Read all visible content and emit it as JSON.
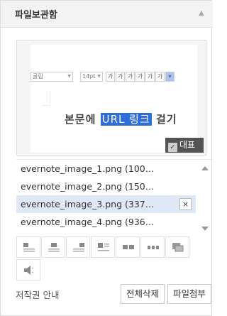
{
  "header": {
    "title": "파일보관함",
    "toggle_icon": "collapse-triangle-icon"
  },
  "preview": {
    "toolbar": {
      "font": "굴림",
      "size": "14pt",
      "buttons": [
        "가",
        "가",
        "가",
        "가",
        "가",
        "가"
      ]
    },
    "text_before": "본문에 ",
    "text_link": "URL 링크",
    "text_after": " 걸기",
    "badge": "대표",
    "badge_checked": true
  },
  "files": [
    {
      "name": "evernote_image_1.png (100…",
      "active": false
    },
    {
      "name": "evernote_image_2.png (150…",
      "active": false
    },
    {
      "name": "evernote_image_3.png (337…",
      "active": true
    },
    {
      "name": "evernote_image_4.png (936…",
      "active": false
    }
  ],
  "delete_symbol": "×",
  "align_buttons": [
    "align-left-icon",
    "align-center-icon",
    "align-right-icon",
    "align-left-full-icon",
    "two-column-icon",
    "three-column-icon",
    "slideshow-icon"
  ],
  "sound_icon": "speaker-icon",
  "footer": {
    "copyright": "저작권 안내",
    "delete_all": "전체삭제",
    "attach": "파일첨부"
  },
  "colors": {
    "link_highlight": "#2f6ed6",
    "active_row": "#dfe8f6",
    "badge_bg": "#545454"
  }
}
